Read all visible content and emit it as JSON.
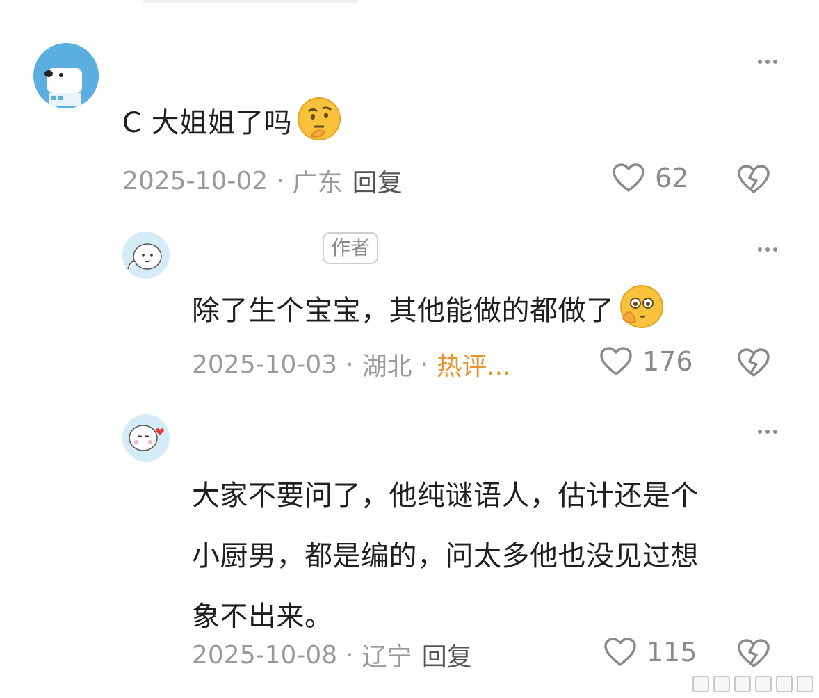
{
  "comments": [
    {
      "text": "C 大姐姐了吗",
      "emoji": "thinking-face-emoji",
      "date": "2025-10-02",
      "location": "广东",
      "reply_label": "回复",
      "likes": "62"
    },
    {
      "author_tag": "作者",
      "text": "除了生个宝宝，其他能做的都做了",
      "emoji": "peeking-face-emoji",
      "date": "2025-10-03",
      "location": "湖北",
      "hot_label": "热评...",
      "likes": "176"
    },
    {
      "text_lines": [
        "大家不要问了，他纯谜语人，估计还是个",
        "小厨男，都是编的，问太多他也没见过想",
        "象不出来。"
      ],
      "date": "2025-10-08",
      "location": "辽宁",
      "reply_label": "回复",
      "likes": "115"
    }
  ],
  "icons": {
    "more": "more-horizontal-icon",
    "like": "heart-outline-icon",
    "dislike": "broken-heart-icon"
  },
  "colors": {
    "hot": "#e8932a",
    "meta": "#9a9a9a",
    "avatar_blue": "#5aaee0"
  }
}
